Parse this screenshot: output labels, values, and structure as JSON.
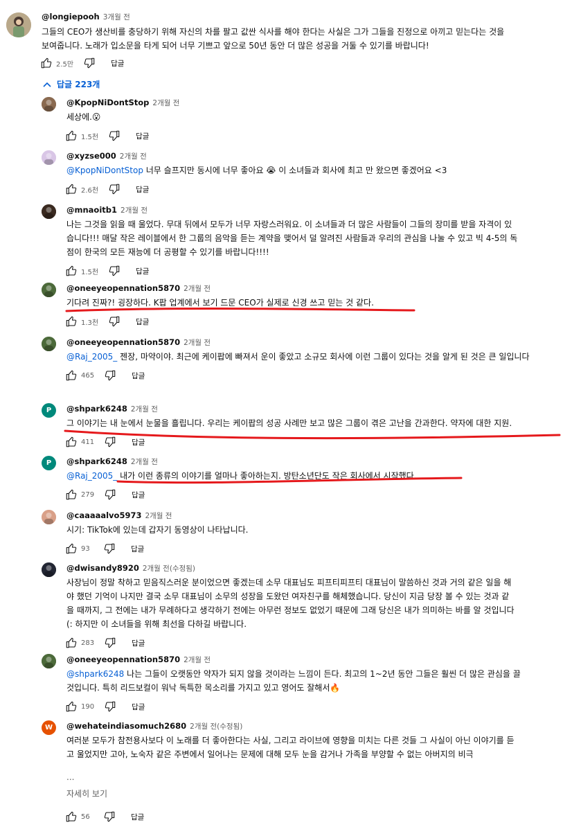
{
  "top_comment": {
    "author": "@longiepooh",
    "time": "3개월 전",
    "text_line1": "그들의 CEO가 생산비를 충당하기 위해 자신의 차를 팔고 값싼 식사를 해야 한다는 사실은 그가 그들을 진정으로 아끼고 믿는다는 것을",
    "text_line2": "보여줍니다. 노래가 입소문을 타게 되어 너무 기쁘고 앞으로 50년 동안 더 많은 성공을 거둘 수 있기를 바랍니다!",
    "likes": "2.5만",
    "reply_label": "답글"
  },
  "replies_toggle": "답글 223개",
  "replies": [
    {
      "author": "@KpopNiDontStop",
      "time": "2개월 전",
      "mention": "",
      "lines": [
        "세상에.😮"
      ],
      "likes": "1.5천",
      "reply_label": "답글"
    },
    {
      "author": "@xyzse000",
      "time": "2개월 전",
      "mention": "@KpopNiDontStop",
      "lines": [
        "너무 슬프지만 동시에 너무 좋아요 😭 이 소녀들과 회사에 최고 만 왔으면 좋겠어요 <3"
      ],
      "likes": "2.6천",
      "reply_label": "답글"
    },
    {
      "author": "@mnaoitb1",
      "time": "2개월 전",
      "mention": "",
      "lines": [
        "나는 그것을 읽을 때 울었다. 무대 뒤에서 모두가 너무 자랑스러워요. 이 소녀들과 더 많은 사람들이 그들의 장미를 받을 자격이 있",
        "습니다!!! 매달 작은 레이블에서 한 그룹의 음악을 듣는 계약을 맺어서 덜 알려진 사람들과 우리의 관심을 나눌 수 있고 빅 4-5의 독",
        "점이 한국의 모든 재능에 더 공평할 수 있기를 바랍니다!!!!"
      ],
      "likes": "1.5천",
      "reply_label": "답글"
    },
    {
      "author": "@oneeyeopennation5870",
      "time": "2개월 전",
      "mention": "",
      "lines": [
        "기다려 진짜?! 굉장하다. K팝 업계에서 보기 드문 CEO가 실제로 신경 쓰고 믿는 것 같다."
      ],
      "likes": "1.3천",
      "reply_label": "답글"
    },
    {
      "author": "@oneeyeopennation5870",
      "time": "2개월 전",
      "mention": "@Raj_2005_",
      "lines": [
        "젠장, 마약이야. 최근에 케이팝에 빠져서 운이 좋았고 소규모 회사에 이런 그룹이 있다는 것을 알게 된 것은 큰 일입니다"
      ],
      "likes": "465",
      "reply_label": "답글"
    },
    {
      "author": "@shpark6248",
      "time": "2개월 전",
      "mention": "",
      "lines": [
        "그 이야기는 내 눈에서 눈물을 흘립니다. 우리는 케이팝의 성공 사례만 보고 많은 그룹이 겪은 고난을 간과한다. 약자에 대한 지원."
      ],
      "likes": "411",
      "reply_label": "답글"
    },
    {
      "author": "@shpark6248",
      "time": "2개월 전",
      "mention": "@Raj_2005_",
      "lines": [
        "내가 이런 종류의 이야기를 얼마나 좋아하는지. 방탄소년단도 작은 회사에서 시작했다."
      ],
      "likes": "279",
      "reply_label": "답글"
    },
    {
      "author": "@caaaaalvo5973",
      "time": "2개월 전",
      "mention": "",
      "lines": [
        "시기: TikTok에 있는데 갑자기 동영상이 나타납니다."
      ],
      "likes": "93",
      "reply_label": "답글"
    },
    {
      "author": "@dwisandy8920",
      "time": "2개월 전(수정됨)",
      "mention": "",
      "lines": [
        "사장님이 정말 착하고 믿음직스러운 분이었으면 좋겠는데 소무 대표님도 피프티피프티 대표님이 말씀하신 것과 거의 같은 일을 해",
        "야 했던 기억이 나지만 결국 소무 대표님이 소무의 성장을 도왔던 여자친구를 해체했습니다. 당신이 지금 당장 볼 수 있는 것과 같",
        "을 때까지, 그 전에는 내가 무례하다고 생각하기 전에는 아무런 정보도 없었기 때문에 그래 당신은 내가 의미하는 바를 알 것입니다",
        "(: 하지만 이 소녀들을 위해 최선을 다하길 바랍니다."
      ],
      "likes": "283",
      "reply_label": "답글"
    },
    {
      "author": "@oneeyeopennation5870",
      "time": "2개월 전",
      "mention": "@shpark6248",
      "lines": [
        "나는 그들이 오랫동안 약자가 되지 않을 것이라는 느낌이 든다. 최고의 1~2년 동안 그들은 훨씬 더 많은 관심을 끌",
        "것입니다. 특히 리드보컬이 워낙 독특한 목소리를 가지고 있고 영어도 잘해서🔥"
      ],
      "likes": "190",
      "reply_label": "답글"
    },
    {
      "author": "@wehateindiasomuch2680",
      "time": "2개월 전(수정됨)",
      "mention": "",
      "lines": [
        "여러분 모두가 참전용사보다 이 노래를 더 좋아한다는 사실, 그리고 라이브에 영향을 미치는 다른 것들 그 사실이 아닌 이야기를 듣",
        "고 울었지만 고아, 노숙자 같은 주변에서 일어나는 문제에 대해 모두 눈을 감거나 가족을 부양할 수 없는 아버지의 비극"
      ],
      "likes": "56",
      "reply_label": "답글",
      "ellipsis": "...",
      "more_label": "자세히 보기"
    }
  ]
}
